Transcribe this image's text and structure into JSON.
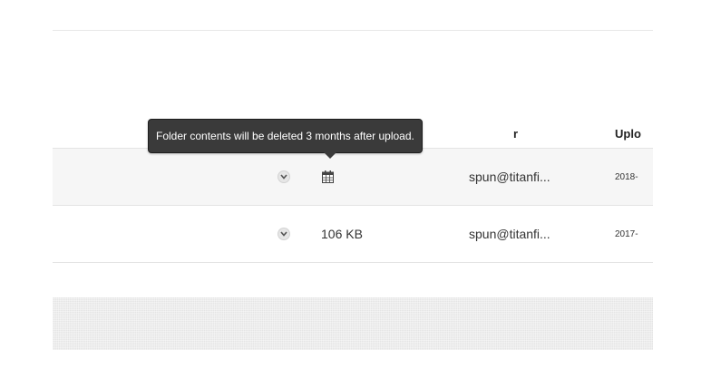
{
  "table": {
    "columns": {
      "owner": "r",
      "uploaded": "Uplo"
    },
    "rows": [
      {
        "size": "",
        "size_icon": "calendar-icon",
        "owner": "spun@titanfi...",
        "uploaded": "2018-"
      },
      {
        "size": "106 KB",
        "owner": "spun@titanfi...",
        "uploaded": "2017-"
      }
    ]
  },
  "tooltip": {
    "text": "Folder contents will be deleted 3 months after upload."
  },
  "colors": {
    "tooltip_bg": "#3a3a3a",
    "row_highlight": "#f6f6f6",
    "footer_bar": "#e5e5e5",
    "divider": "#e4e4e4"
  }
}
